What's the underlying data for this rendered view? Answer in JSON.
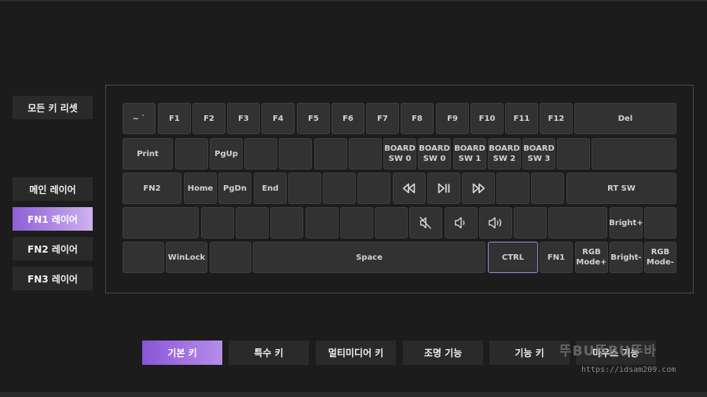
{
  "side": {
    "reset": "모든 키 리셋",
    "layers": [
      "메인 레이어",
      "FN1 레이어",
      "FN2 레이어",
      "FN3 레이어"
    ],
    "active_layer": "FN1 레이어"
  },
  "keyboard": {
    "row1": [
      "~ `",
      "F1",
      "F2",
      "F3",
      "F4",
      "F5",
      "F6",
      "F7",
      "F8",
      "F9",
      "F10",
      "F11",
      "F12",
      "Del"
    ],
    "row2": [
      "Print",
      "",
      "PgUp",
      "",
      "",
      "",
      "",
      "BOARD\nSW 0",
      "BOARD\nSW 1",
      "BOARD\nSW 2",
      "BOARD\nSW 3",
      "",
      ""
    ],
    "row3": [
      "FN2",
      "Home",
      "PgDn",
      "End",
      "",
      "",
      "",
      "prev-track-icon",
      "play-pause-icon",
      "next-track-icon",
      "",
      "",
      "RT SW"
    ],
    "row4": [
      "",
      "",
      "",
      "",
      "",
      "",
      "",
      "mute-icon",
      "volume-down-icon",
      "volume-up-icon",
      "",
      "",
      "Bright+",
      ""
    ],
    "row5": [
      "",
      "WinLock",
      "",
      "Space",
      "CTRL",
      "FN1",
      "RGB\nMode+",
      "Bright-",
      "RGB\nMode-"
    ],
    "selected_key": "CTRL"
  },
  "tabs": [
    "기본 키",
    "특수 키",
    "멀티미디어 키",
    "조명 기능",
    "기능 키",
    "마우스 기능"
  ],
  "active_tab": "기본 키",
  "watermark": {
    "title": "뚜BU뚜BU뚜바",
    "url": "https://idsam209.com"
  },
  "colors": {
    "accent": "#8f5ed6",
    "key_bg": "#323232",
    "bg": "#1c1c1c"
  }
}
